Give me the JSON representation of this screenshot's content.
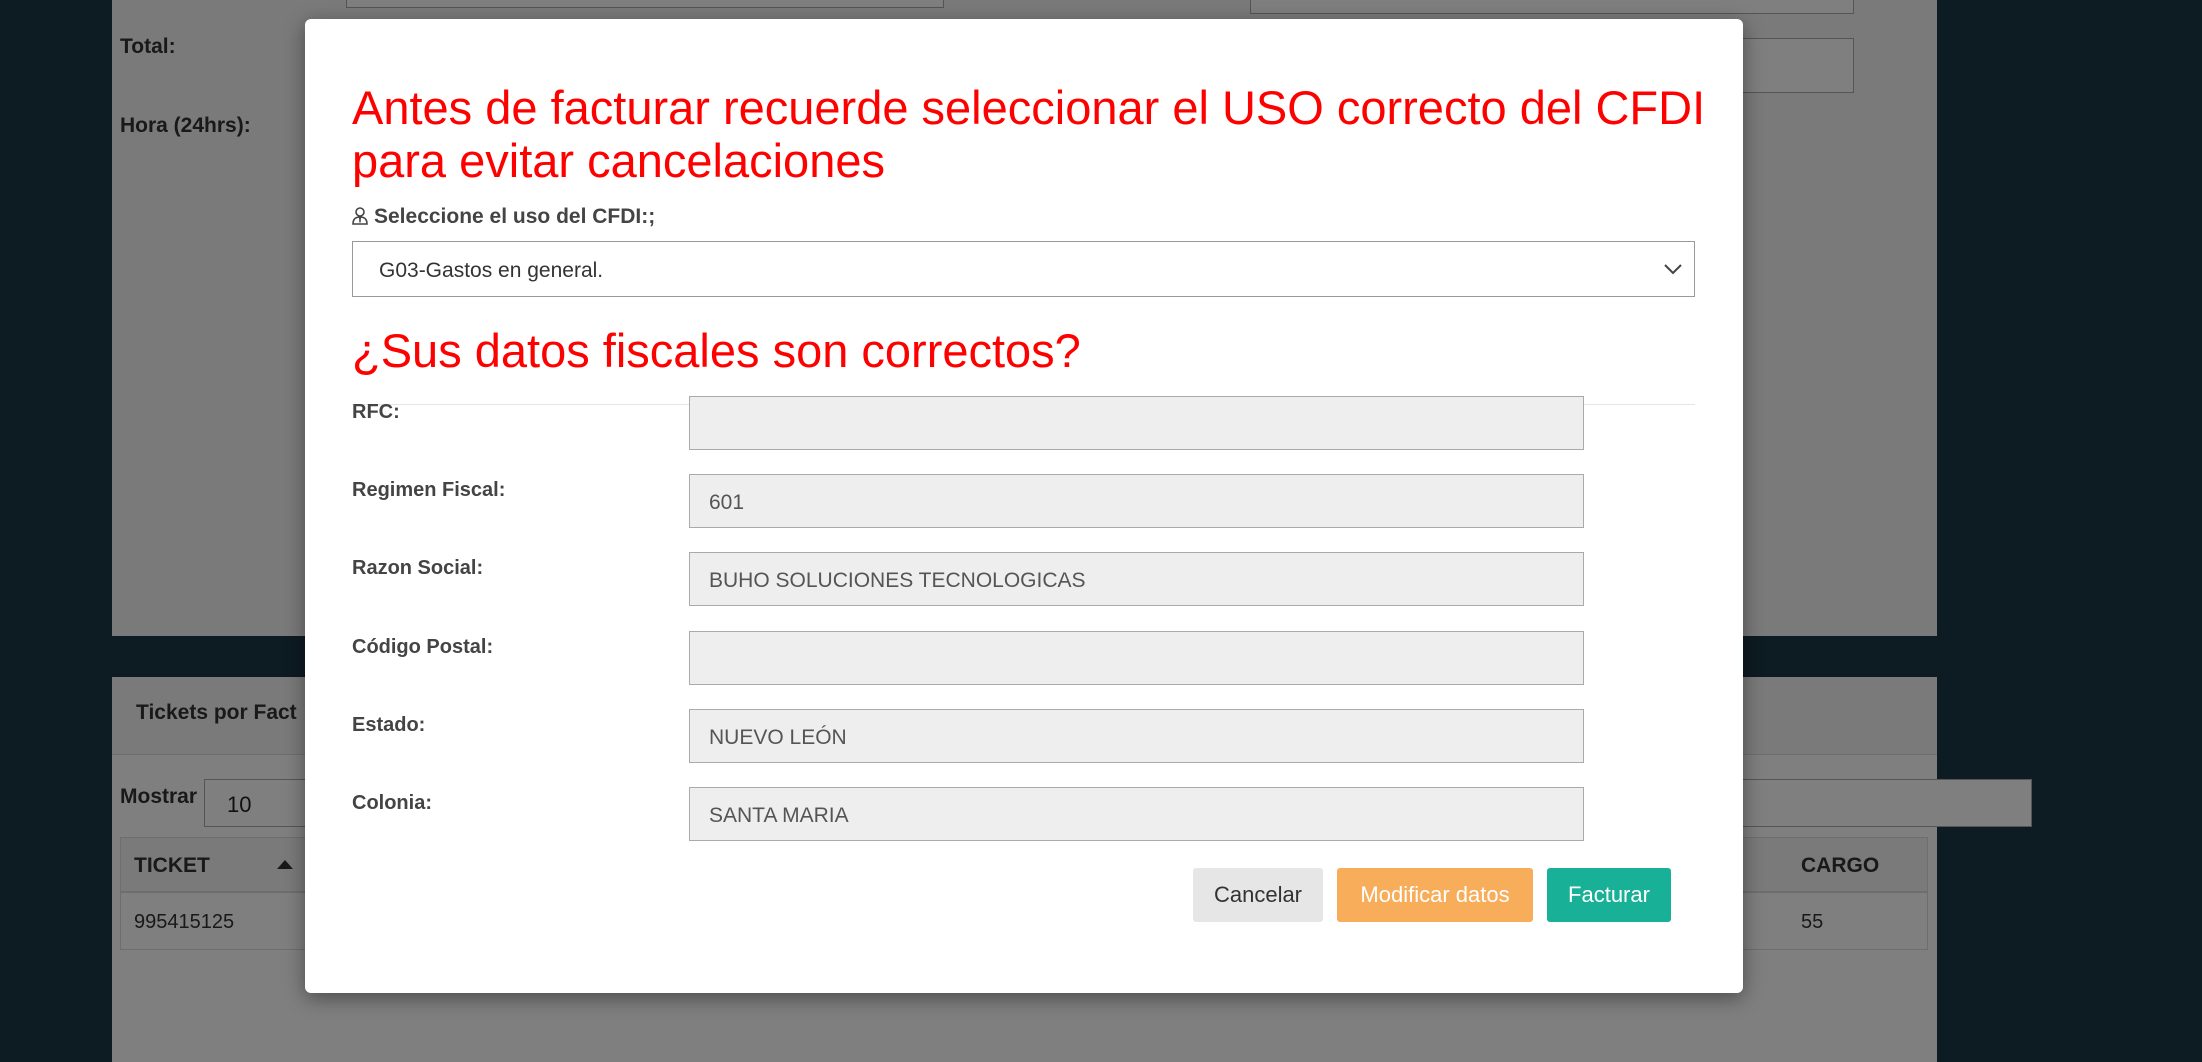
{
  "background": {
    "labels": {
      "total": "Total:",
      "hora": "Hora (24hrs):"
    },
    "tickets_panel": {
      "title": "Tickets por Fact",
      "mostrar_label": "Mostrar",
      "page_size": "10",
      "columns": [
        "TICKET",
        "CARGO"
      ],
      "rows": [
        {
          "ticket": "995415125",
          "cargo": "55"
        }
      ]
    }
  },
  "modal": {
    "title": "Antes de facturar recuerde seleccionar el USO correcto del CFDI para evitar cancelaciones",
    "cfdi_label": "Seleccione el uso del CFDI:;",
    "cfdi_icon": "user-tie-icon",
    "cfdi_selected": "G03-Gastos en general.",
    "subtitle": "¿Sus datos fiscales son correctos?",
    "fields": {
      "rfc": {
        "label": "RFC:",
        "value": ""
      },
      "regimen": {
        "label": "Regimen Fiscal:",
        "value": "601"
      },
      "razon": {
        "label": "Razon Social:",
        "value": "BUHO SOLUCIONES TECNOLOGICAS"
      },
      "cp": {
        "label": "Código Postal:",
        "value": ""
      },
      "estado": {
        "label": "Estado:",
        "value": "NUEVO LEÓN"
      },
      "colonia": {
        "label": "Colonia:",
        "value": "SANTA MARIA"
      }
    },
    "buttons": {
      "cancel": "Cancelar",
      "modify": "Modificar datos",
      "facturar": "Facturar"
    }
  },
  "colors": {
    "title_red": "#ff0000",
    "modify_orange": "#f8ad5a",
    "facturar_teal": "#18b096",
    "page_bg": "#1b3644"
  }
}
